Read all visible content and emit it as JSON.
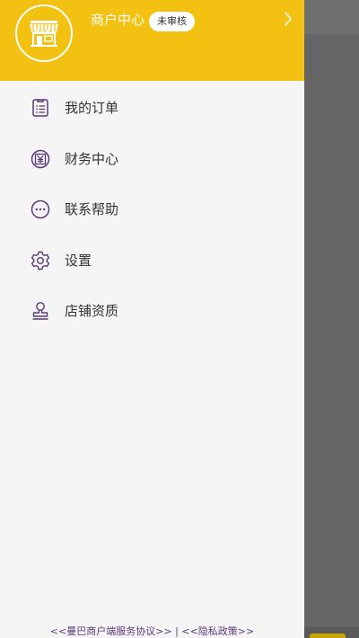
{
  "header": {
    "shop_name": "商户中心",
    "status_badge": "未审核"
  },
  "menu": {
    "items": [
      {
        "label": "我的订单",
        "icon": "order-list-icon"
      },
      {
        "label": "财务中心",
        "icon": "finance-yuan-icon"
      },
      {
        "label": "联系帮助",
        "icon": "chat-help-icon"
      },
      {
        "label": "设置",
        "icon": "gear-icon"
      },
      {
        "label": "店铺资质",
        "icon": "stamp-icon"
      }
    ]
  },
  "footer": {
    "agreement_link": "<<曼巴商户端服务协议>>",
    "separator": "|",
    "privacy_link": "<<隐私政策>>"
  },
  "colors": {
    "header_bg": "#f2c111",
    "icon_purple": "#5c3a7a",
    "drawer_bg": "#f5f5f5",
    "overlay": "#656565"
  }
}
